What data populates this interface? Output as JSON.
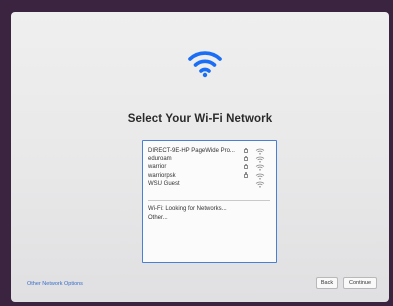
{
  "setup": {
    "title": "Select Your Wi-Fi Network",
    "header_icon": "wifi-icon",
    "accent_color": "#1a6ef5"
  },
  "networks": [
    {
      "name": "DIRECT-9E-HP PageWide Pro...",
      "locked": true,
      "icon": "wifi-signal-icon"
    },
    {
      "name": "eduroam",
      "locked": true,
      "icon": "wifi-signal-icon"
    },
    {
      "name": "warrior",
      "locked": true,
      "icon": "wifi-signal-icon"
    },
    {
      "name": "warriorpsk",
      "locked": true,
      "icon": "wifi-signal-icon"
    },
    {
      "name": "WSU Guest",
      "locked": false,
      "icon": "wifi-signal-icon"
    }
  ],
  "status": {
    "looking": "Wi-Fi: Looking for Networks...",
    "other": "Other..."
  },
  "footer": {
    "other_options": "Other Network Options",
    "back_label": "Back",
    "continue_label": "Continue"
  }
}
